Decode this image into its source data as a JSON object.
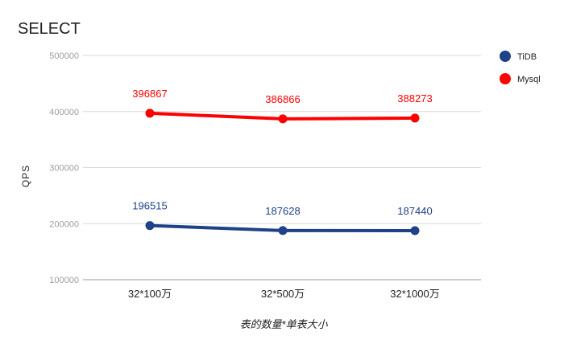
{
  "chart_data": {
    "type": "line",
    "title": "SELECT",
    "ylabel": "QPS",
    "xlabel": "表的数量*单表大小",
    "categories": [
      "32*100万",
      "32*500万",
      "32*1000万"
    ],
    "ylim": [
      100000,
      500000
    ],
    "yticks": [
      100000,
      200000,
      300000,
      400000,
      500000
    ],
    "grid": true,
    "legend_position": "right",
    "series": [
      {
        "name": "TiDB",
        "color": "#1f4188",
        "values": [
          196515,
          187628,
          187440
        ]
      },
      {
        "name": "Mysql",
        "color": "#ff0000",
        "values": [
          396867,
          386866,
          388273
        ]
      }
    ]
  }
}
